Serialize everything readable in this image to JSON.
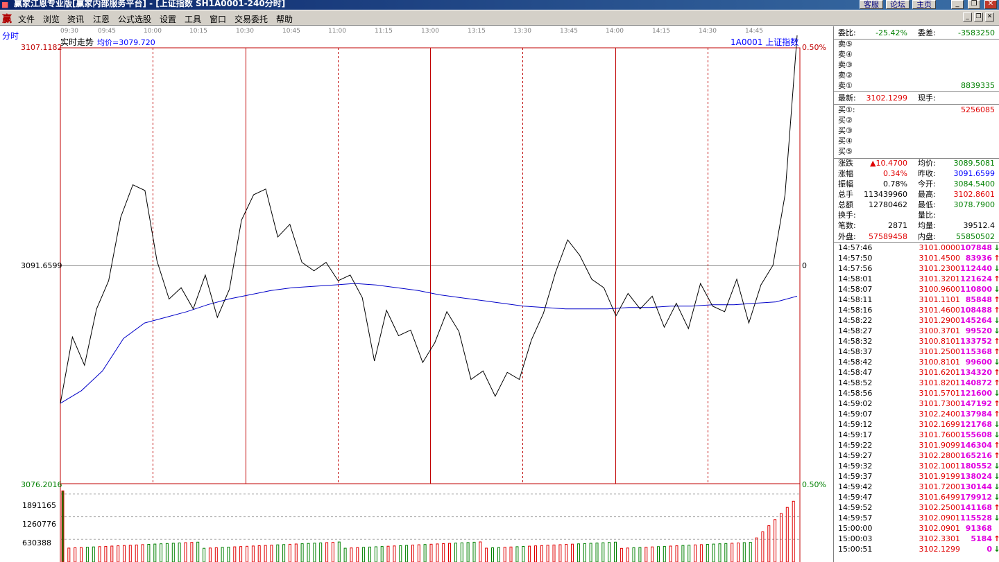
{
  "window": {
    "title": "赢家江恩专业版[赢家内部服务平台] - [上证指数   SH1A0001-240分时]",
    "right_buttons": [
      "客服",
      "论坛",
      "主页"
    ],
    "controls": [
      "_",
      "❐",
      "✕"
    ]
  },
  "menu": {
    "items": [
      "文件",
      "浏览",
      "资讯",
      "江恩",
      "公式选股",
      "设置",
      "工具",
      "窗口",
      "交易委托",
      "帮助"
    ],
    "mdi_controls": [
      "_",
      "❐",
      "✕"
    ]
  },
  "sidebar": {
    "label": "分时"
  },
  "chart": {
    "title": "实时走势",
    "avg_label": "均价=3079.720",
    "symbol_label": "1A0001  上证指数",
    "time_labels": [
      "09:30",
      "09:45",
      "10:00",
      "10:15",
      "10:30",
      "10:45",
      "11:00",
      "11:15",
      "13:00",
      "13:15",
      "13:30",
      "13:45",
      "14:00",
      "14:15",
      "14:30",
      "14:45"
    ],
    "price_axis": {
      "top": "3107.1182",
      "mid": "3091.6599",
      "bottom": "3076.2016"
    },
    "pct_axis": {
      "top": "0.50%",
      "mid": "0",
      "bottom": "0.50%"
    },
    "volume_axis": [
      "1891165",
      "1260776",
      "630388"
    ],
    "colors": {
      "price_line": "#000000",
      "avg_line": "#0000c8",
      "frame": "#c00000",
      "up_bar": "#e00000",
      "down_bar": "#008000"
    }
  },
  "chart_data": {
    "type": "line",
    "series": [
      {
        "values": [
          3081.9,
          3086.6,
          3084.6,
          3088.6,
          3090.6,
          3095.1,
          3097.4,
          3097.0,
          3092.0,
          3089.3,
          3090.1,
          3088.6,
          3091.0,
          3088.0,
          3090.0,
          3094.9,
          3096.7,
          3097.1,
          3093.7,
          3094.6,
          3091.9,
          3091.3,
          3091.9,
          3090.6,
          3091.0,
          3089.4,
          3084.9,
          3088.5,
          3086.7,
          3087.1,
          3084.8,
          3086.2,
          3088.4,
          3087.0,
          3083.6,
          3084.2,
          3082.4,
          3084.1,
          3083.6,
          3086.4,
          3088.3,
          3091.2,
          3093.5,
          3092.4,
          3090.7,
          3090.1,
          3088.1,
          3089.7,
          3088.6,
          3089.5,
          3087.3,
          3089.0,
          3087.2,
          3090.4,
          3088.8,
          3088.4,
          3090.7,
          3087.6,
          3090.3,
          3091.7,
          3096.7,
          3108.0
        ],
        "role": "price"
      },
      {
        "values": [
          3081.9,
          3082.8,
          3084.2,
          3086.5,
          3087.6,
          3088.0,
          3088.4,
          3088.9,
          3089.3,
          3089.6,
          3089.9,
          3090.1,
          3090.2,
          3090.3,
          3090.4,
          3090.3,
          3090.1,
          3089.9,
          3089.6,
          3089.4,
          3089.2,
          3089.0,
          3088.8,
          3088.7,
          3088.6,
          3088.6,
          3088.6,
          3088.7,
          3088.7,
          3088.8,
          3088.8,
          3088.9,
          3088.9,
          3089.0,
          3089.1,
          3089.5
        ],
        "role": "average"
      }
    ],
    "ylim": [
      3076.2016,
      3107.1182
    ],
    "volume_ticks": [
      1891165,
      1260776,
      630388
    ]
  },
  "quote": {
    "weibi_label": "委比:",
    "weibi": "-25.42%",
    "weicha_label": "委差:",
    "weicha": "-3583250",
    "asks": [
      {
        "label": "卖⑤",
        "vol": ""
      },
      {
        "label": "卖④",
        "vol": ""
      },
      {
        "label": "卖③",
        "vol": ""
      },
      {
        "label": "卖②",
        "vol": ""
      },
      {
        "label": "卖①",
        "vol": "8839335"
      }
    ],
    "latest_label": "最新:",
    "latest": "3102.1299",
    "xianshou_label": "现手:",
    "bids": [
      {
        "label": "买①:",
        "vol": "5256085"
      },
      {
        "label": "买②",
        "vol": ""
      },
      {
        "label": "买③",
        "vol": ""
      },
      {
        "label": "买④",
        "vol": ""
      },
      {
        "label": "买⑤",
        "vol": ""
      }
    ],
    "stats": [
      {
        "k": "涨跌",
        "v": "▲10.4700",
        "vc": "red",
        "k2": "均价:",
        "v2": "3089.5081",
        "v2c": "green"
      },
      {
        "k": "涨幅",
        "v": "0.34%",
        "vc": "red",
        "k2": "昨收:",
        "v2": "3091.6599",
        "v2c": "blue"
      },
      {
        "k": "振幅",
        "v": "0.78%",
        "vc": "",
        "k2": "今开:",
        "v2": "3084.5400",
        "v2c": "green"
      },
      {
        "k": "总手",
        "v": "113439960",
        "vc": "",
        "k2": "最高:",
        "v2": "3102.8601",
        "v2c": "red"
      },
      {
        "k": "总额",
        "v": "12780462",
        "vc": "",
        "k2": "最低:",
        "v2": "3078.7900",
        "v2c": "green"
      },
      {
        "k": "换手:",
        "v": "",
        "vc": "",
        "k2": "量比:",
        "v2": "",
        "v2c": ""
      },
      {
        "k": "笔数:",
        "v": "2871",
        "vc": "",
        "k2": "均量:",
        "v2": "39512.4",
        "v2c": ""
      }
    ],
    "waipan_label": "外盘:",
    "waipan": "57589458",
    "neipan_label": "内盘:",
    "neipan": "55850502"
  },
  "ticks": [
    {
      "t": "14:57:46",
      "p": "3101.0000",
      "v": "107848",
      "d": "dn"
    },
    {
      "t": "14:57:50",
      "p": "3101.4500",
      "v": "83936",
      "d": "up"
    },
    {
      "t": "14:57:56",
      "p": "3101.2300",
      "v": "112440",
      "d": "dn"
    },
    {
      "t": "14:58:01",
      "p": "3101.3201",
      "v": "121624",
      "d": "up"
    },
    {
      "t": "14:58:07",
      "p": "3100.9600",
      "v": "110800",
      "d": "dn"
    },
    {
      "t": "14:58:11",
      "p": "3101.1101",
      "v": "85848",
      "d": "up"
    },
    {
      "t": "14:58:16",
      "p": "3101.4600",
      "v": "108488",
      "d": "up"
    },
    {
      "t": "14:58:22",
      "p": "3101.2900",
      "v": "145264",
      "d": "dn"
    },
    {
      "t": "14:58:27",
      "p": "3100.3701",
      "v": "99520",
      "d": "dn"
    },
    {
      "t": "14:58:32",
      "p": "3100.8101",
      "v": "133752",
      "d": "up"
    },
    {
      "t": "14:58:37",
      "p": "3101.2500",
      "v": "115368",
      "d": "up"
    },
    {
      "t": "14:58:42",
      "p": "3100.8101",
      "v": "99600",
      "d": "dn"
    },
    {
      "t": "14:58:47",
      "p": "3101.6201",
      "v": "134320",
      "d": "up"
    },
    {
      "t": "14:58:52",
      "p": "3101.8201",
      "v": "140872",
      "d": "up"
    },
    {
      "t": "14:58:56",
      "p": "3101.5701",
      "v": "121600",
      "d": "dn"
    },
    {
      "t": "14:59:02",
      "p": "3101.7300",
      "v": "147192",
      "d": "up"
    },
    {
      "t": "14:59:07",
      "p": "3102.2400",
      "v": "137984",
      "d": "up"
    },
    {
      "t": "14:59:12",
      "p": "3102.1699",
      "v": "121768",
      "d": "dn"
    },
    {
      "t": "14:59:17",
      "p": "3101.7600",
      "v": "155608",
      "d": "dn"
    },
    {
      "t": "14:59:22",
      "p": "3101.9099",
      "v": "146304",
      "d": "up"
    },
    {
      "t": "14:59:27",
      "p": "3102.2800",
      "v": "165216",
      "d": "up"
    },
    {
      "t": "14:59:32",
      "p": "3102.1001",
      "v": "180552",
      "d": "dn"
    },
    {
      "t": "14:59:37",
      "p": "3101.9199",
      "v": "138024",
      "d": "dn"
    },
    {
      "t": "14:59:42",
      "p": "3101.7200",
      "v": "130144",
      "d": "dn"
    },
    {
      "t": "14:59:47",
      "p": "3101.6499",
      "v": "179912",
      "d": "dn"
    },
    {
      "t": "14:59:52",
      "p": "3102.2500",
      "v": "141168",
      "d": "up"
    },
    {
      "t": "14:59:57",
      "p": "3102.0901",
      "v": "115528",
      "d": "dn"
    },
    {
      "t": "15:00:00",
      "p": "3102.0901",
      "v": "91368",
      "d": ""
    },
    {
      "t": "15:00:03",
      "p": "3102.3301",
      "v": "5184",
      "d": "up"
    },
    {
      "t": "15:00:51",
      "p": "3102.1299",
      "v": "0",
      "d": "dn"
    }
  ]
}
